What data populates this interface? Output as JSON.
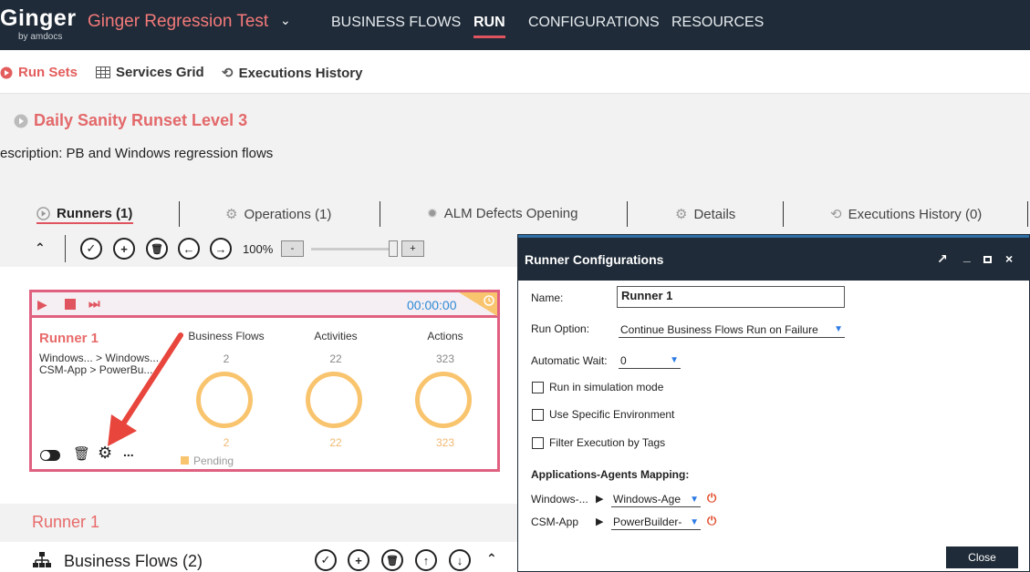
{
  "app": {
    "logo": "Ginger",
    "logo_sub": "by amdocs",
    "solution": "Ginger Regression Test"
  },
  "nav": {
    "items": [
      "BUSINESS FLOWS",
      "RUN",
      "CONFIGURATIONS",
      "RESOURCES"
    ],
    "active": "RUN"
  },
  "subnav": {
    "run_sets": "Run Sets",
    "services_grid": "Services Grid",
    "executions_history": "Executions History"
  },
  "runset": {
    "title": "Daily Sanity Runset Level 3",
    "description": "escription: PB and Windows regression flows"
  },
  "tabs": [
    "Runners (1)",
    "Operations (1)",
    "ALM Defects Opening",
    "Details",
    "Executions History (0)"
  ],
  "toolbar": {
    "zoom": "100%",
    "zoom_minus": "-",
    "zoom_plus": "+"
  },
  "runner_card": {
    "name": "Runner 1",
    "timer": "00:00:00",
    "app_line1": "Windows... > Windows...",
    "app_line2": "CSM-App > PowerBu...",
    "stats": [
      {
        "title": "Business Flows",
        "top": "2",
        "bottom": "2"
      },
      {
        "title": "Activities",
        "top": "22",
        "bottom": "22"
      },
      {
        "title": "Actions",
        "top": "323",
        "bottom": "323"
      }
    ],
    "status": "Pending",
    "more": "..."
  },
  "runner_section": {
    "title": "Runner 1",
    "business_flows": "Business Flows (2)"
  },
  "dialog": {
    "title": "Runner Configurations",
    "name_label": "Name:",
    "name_value": "Runner 1",
    "run_option_label": "Run Option:",
    "run_option_value": "Continue Business Flows Run on Failure",
    "auto_wait_label": "Automatic Wait:",
    "auto_wait_value": "0",
    "simulation": "Run in simulation mode",
    "specific_env": "Use Specific Environment",
    "filter_tags": "Filter Execution by Tags",
    "mapping_title": "Applications-Agents Mapping:",
    "mappings": [
      {
        "app": "Windows-...",
        "agent": "Windows-Age"
      },
      {
        "app": "CSM-App",
        "agent": "PowerBuilder-"
      }
    ],
    "close": "Close"
  }
}
